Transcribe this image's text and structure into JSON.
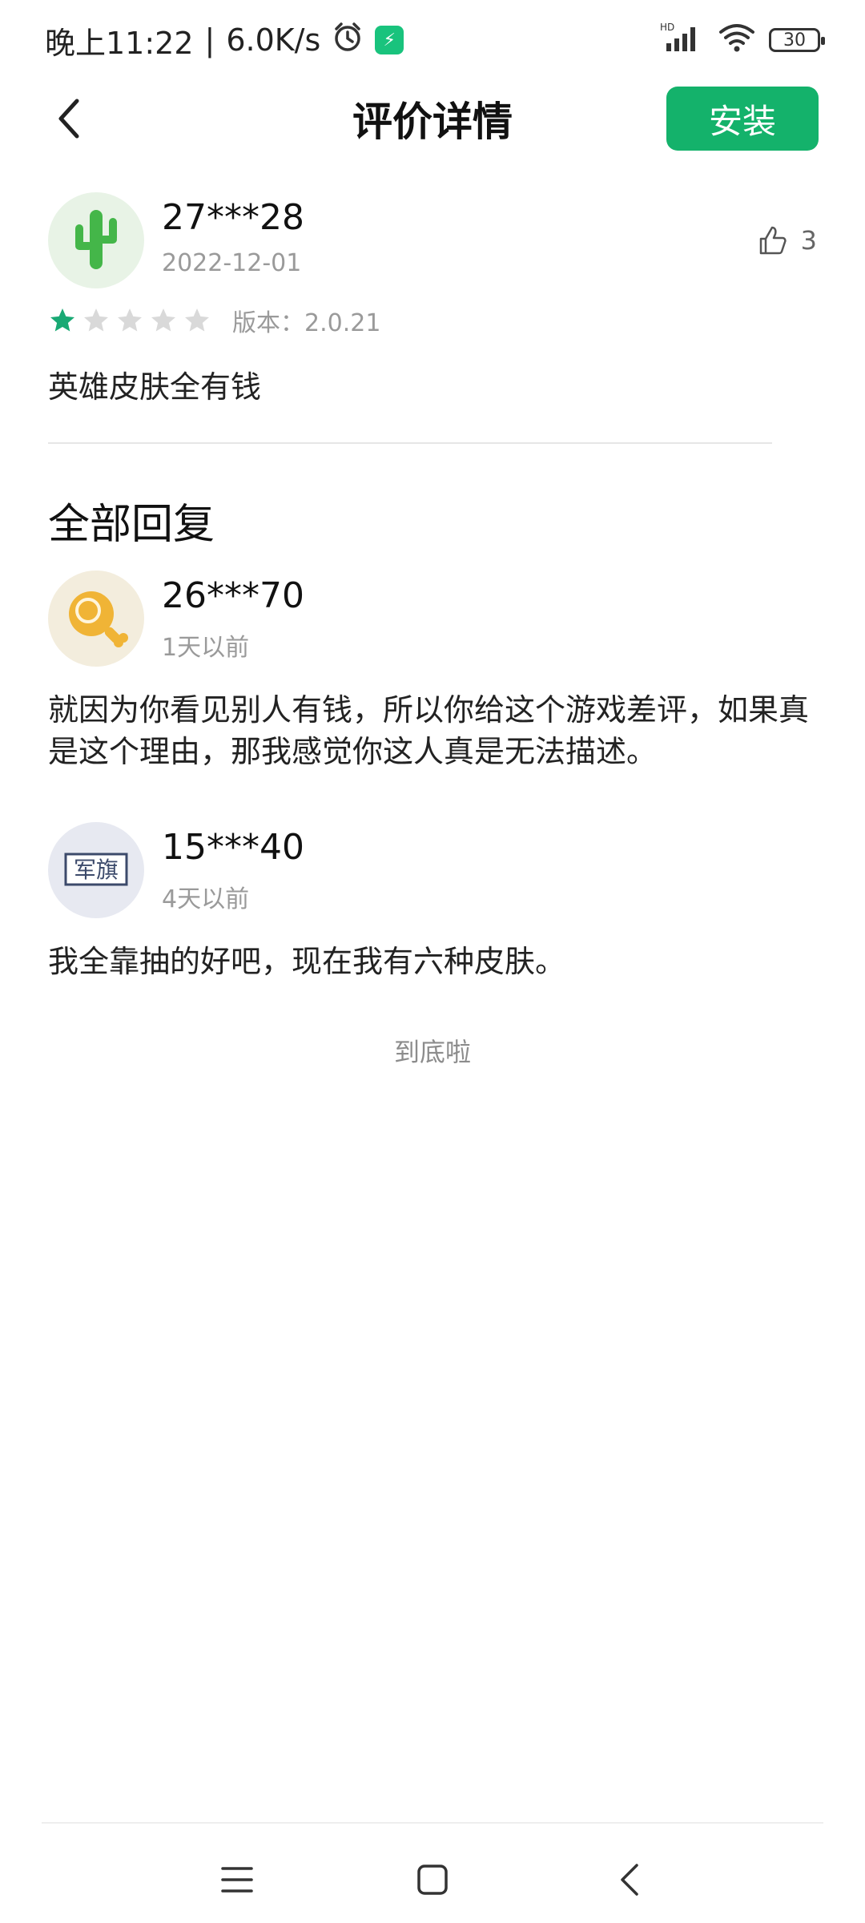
{
  "status_bar": {
    "time": "晚上11:22",
    "speed": "6.0K/s",
    "battery": "30",
    "network": "HD"
  },
  "header": {
    "title": "评价详情",
    "install_label": "安装"
  },
  "review": {
    "user": "27***28",
    "date": "2022-12-01",
    "likes": "3",
    "rating": 1,
    "rating_max": 5,
    "version": "版本：2.0.21",
    "text": "英雄皮肤全有钱"
  },
  "replies": {
    "title": "全部回复",
    "items": [
      {
        "user": "26***70",
        "time": "1天以前",
        "text": "就因为你看见别人有钱，所以你给这个游戏差评，如果真是这个理由，那我感觉你这人真是无法描述。",
        "avatar": "meat-icon"
      },
      {
        "user": "15***40",
        "time": "4天以前",
        "text": "我全靠抽的好吧，现在我有六种皮肤。",
        "avatar_text": "军旗"
      }
    ]
  },
  "end_text": "到底啦",
  "colors": {
    "accent": "#14b26b",
    "star_active": "#19a974",
    "star_inactive": "#d9d9d9"
  }
}
